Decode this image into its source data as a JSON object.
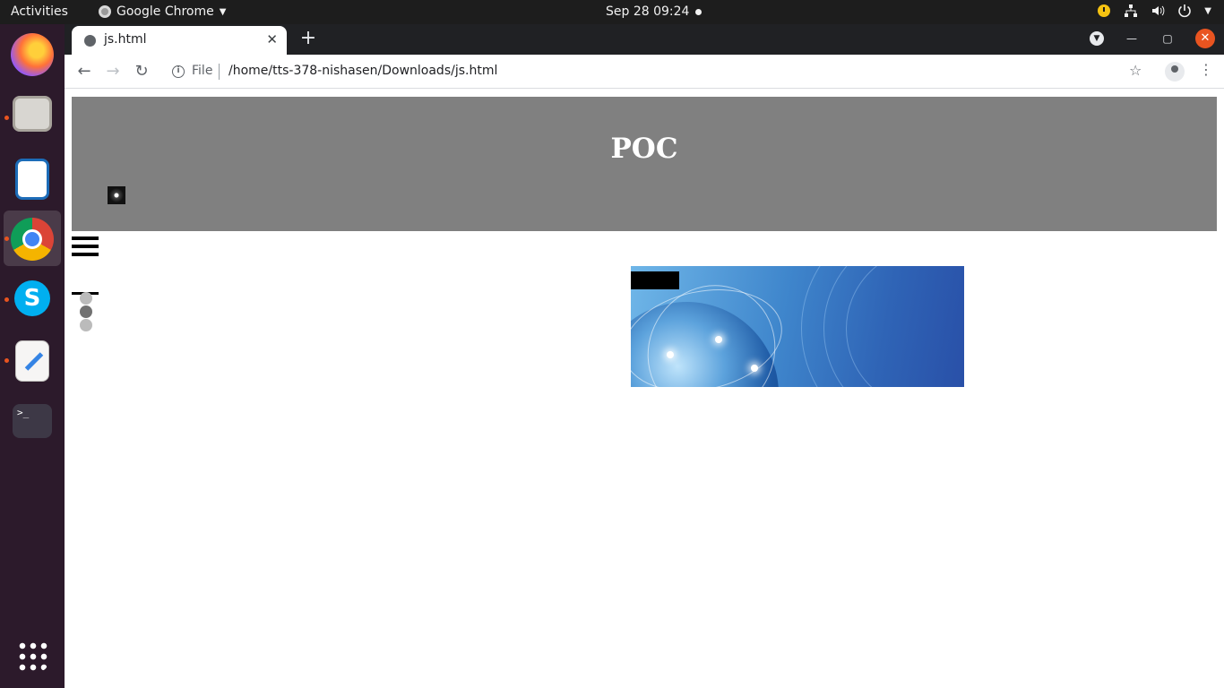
{
  "os": {
    "activities": "Activities",
    "app_name": "Google Chrome",
    "clock": "Sep 28  09:24"
  },
  "dock": {
    "items": [
      "firefox-icon",
      "files-icon",
      "libreoffice-impress-icon",
      "chrome-icon",
      "skype-icon",
      "text-editor-icon",
      "terminal-icon",
      "app-grid-icon"
    ]
  },
  "browser": {
    "tab_title": "js.html",
    "new_tab": "+",
    "tab_close": "✕",
    "scheme": "File",
    "url": "/home/tts-378-nishasen/Downloads/js.html"
  },
  "page": {
    "heading": "POC"
  },
  "colors": {
    "banner": "#808080",
    "dock": "#2c1a2b",
    "topbar": "#1d1d1d",
    "accent": "#e95420"
  }
}
